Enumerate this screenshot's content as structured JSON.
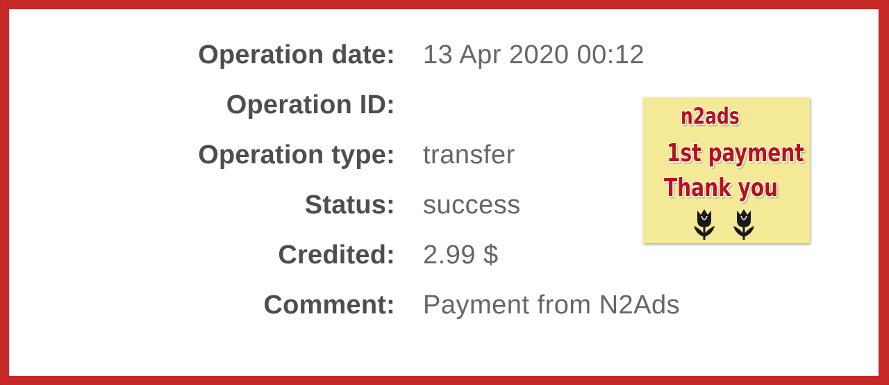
{
  "details": {
    "rows": [
      {
        "label": "Operation date:",
        "value": "13 Apr 2020 00:12"
      },
      {
        "label": "Operation ID:",
        "value": ""
      },
      {
        "label": "Operation type:",
        "value": "transfer"
      },
      {
        "label": "Status:",
        "value": "success"
      },
      {
        "label": "Credited:",
        "value": "2.99 $"
      },
      {
        "label": "Comment:",
        "value": "Payment from N2Ads"
      }
    ]
  },
  "sticker": {
    "line1": "n2ads",
    "line2": "1st payment",
    "line3": "Thank you",
    "icons": [
      "tulip-icon",
      "tulip-icon"
    ],
    "background_color": "#f4e996",
    "text_color": "#b5121b"
  },
  "colors": {
    "frame": "#c62828",
    "label": "#4e4e4e",
    "value": "#666666"
  }
}
